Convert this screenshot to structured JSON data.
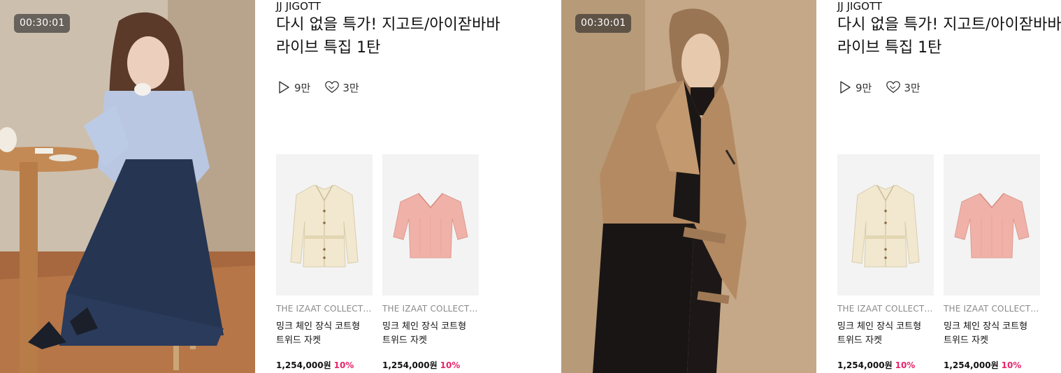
{
  "cards": [
    {
      "timer": "00:30:01",
      "brand": "JJ JIGOTT",
      "title": "다시 없을 특가! 지고트/아이잗바바 라이브 특집 1탄",
      "views": "9만",
      "likes": "3만",
      "products": [
        {
          "brand": "THE IZAAT COLLECTION",
          "name": "밍크 체인 장식 코트형 트위드 자켓",
          "price": "1,254,000원",
          "discount": "10%",
          "image_icon": "cream-belted-jacket-icon"
        },
        {
          "brand": "THE IZAAT COLLECTION",
          "name": "밍크 체인 장식 코트형 트위드 자켓",
          "price": "1,254,000원",
          "discount": "10%",
          "image_icon": "pink-knit-sweater-icon"
        }
      ]
    },
    {
      "timer": "00:30:01",
      "brand": "JJ JIGOTT",
      "title": "다시 없을 특가! 지고트/아이잗바바 라이브 특집 1탄",
      "views": "9만",
      "likes": "3만",
      "products": [
        {
          "brand": "THE IZAAT COLLECTION",
          "name": "밍크 체인 장식 코트형 트위드 자켓",
          "price": "1,254,000원",
          "discount": "10%",
          "image_icon": "cream-belted-jacket-icon"
        },
        {
          "brand": "THE IZAAT COLLECTION",
          "name": "밍크 체인 장식 코트형 트위드 자켓",
          "price": "1,254,000원",
          "discount": "10%",
          "image_icon": "pink-knit-sweater-icon"
        }
      ]
    }
  ],
  "colors": {
    "discount": "#e8256a",
    "thumb_bg": "#f3f3f3",
    "timer_bg": "#282828"
  }
}
